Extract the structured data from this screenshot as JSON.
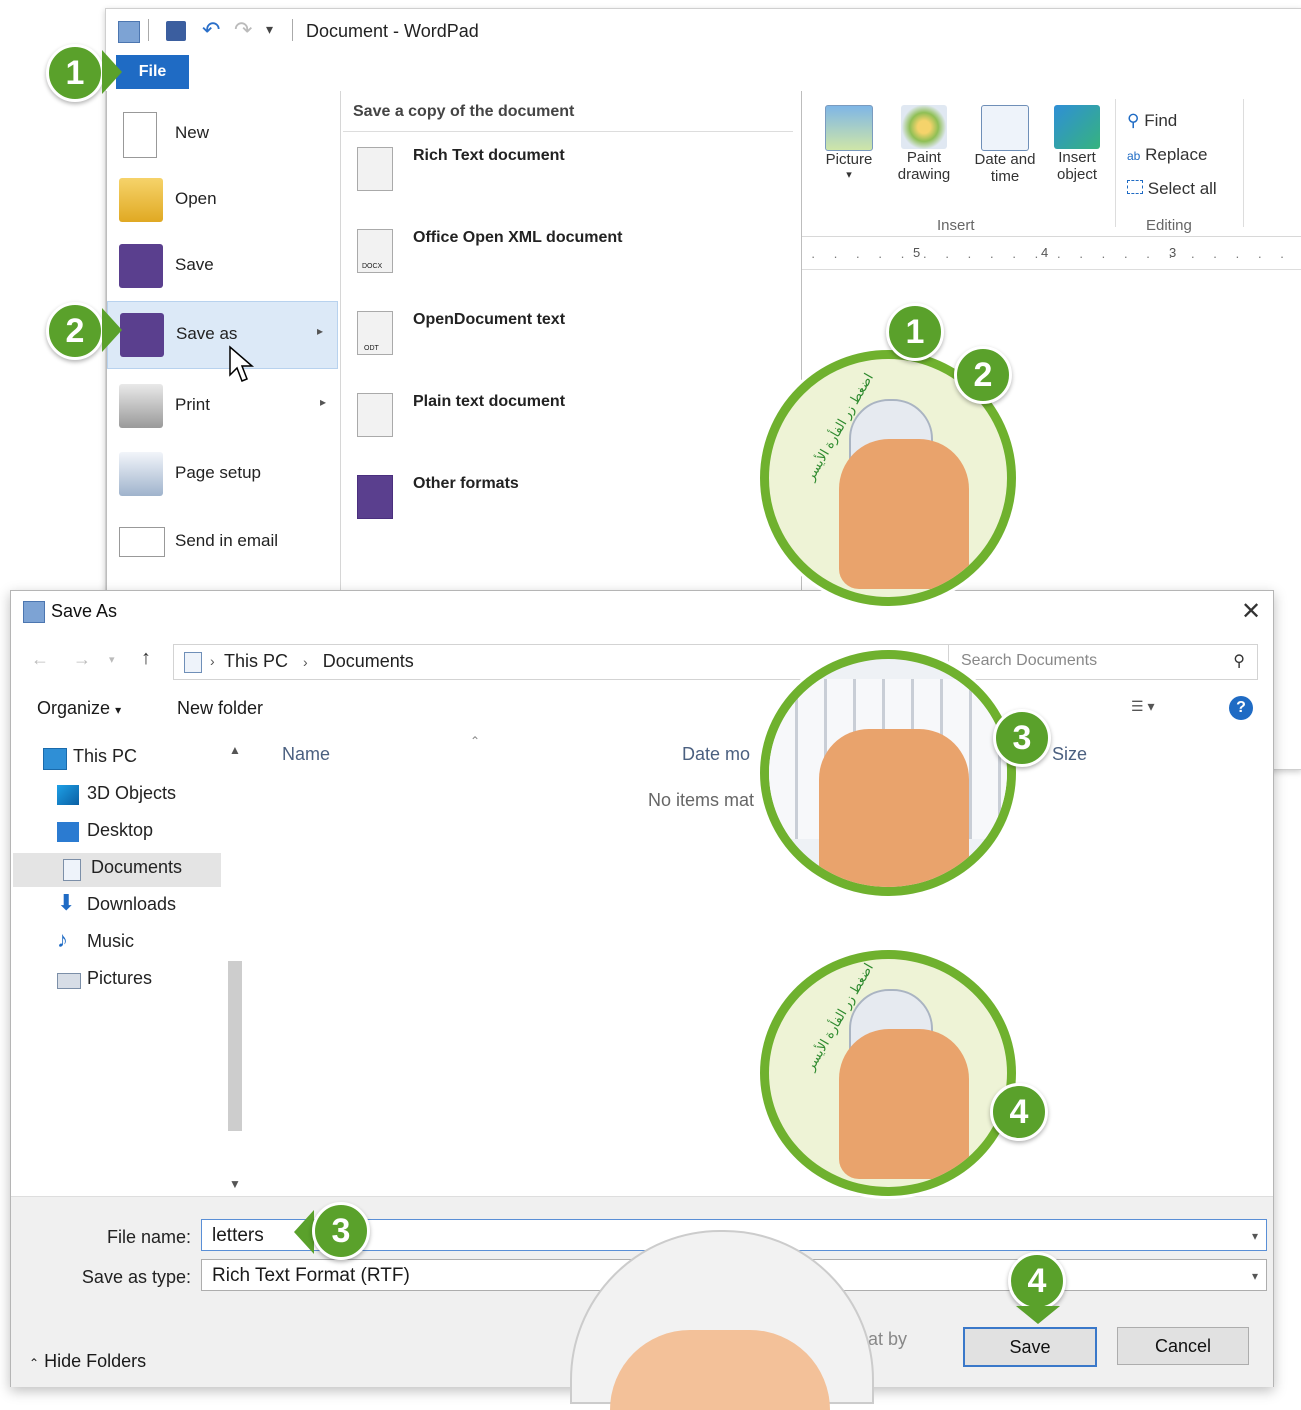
{
  "wordpad": {
    "title": "Document - WordPad",
    "file_tab": "File",
    "ribbon": {
      "insert": {
        "picture": "Picture",
        "paint_drawing": [
          "Paint",
          "drawing"
        ],
        "date_time": [
          "Date and",
          "time"
        ],
        "insert_object": [
          "Insert",
          "object"
        ],
        "group_label": "Insert"
      },
      "editing": {
        "find": "Find",
        "replace": "Replace",
        "select_all": "Select all",
        "group_label": "Editing"
      }
    },
    "ruler_marks": [
      "5",
      "4",
      "3"
    ],
    "file_menu": {
      "items": [
        {
          "label": "New"
        },
        {
          "label": "Open"
        },
        {
          "label": "Save"
        },
        {
          "label": "Save as"
        },
        {
          "label": "Print"
        },
        {
          "label": "Page setup"
        },
        {
          "label": "Send in email"
        }
      ],
      "submenu_title": "Save a copy of the document",
      "submenu": [
        {
          "label": "Rich Text document"
        },
        {
          "label": "Office Open XML document"
        },
        {
          "label": "OpenDocument text"
        },
        {
          "label": "Plain text document"
        },
        {
          "label": "Other formats"
        }
      ],
      "icon_badges": {
        "docx": "DOCX",
        "odt": "ODT"
      }
    }
  },
  "dialog": {
    "title": "Save As",
    "breadcrumb": [
      "This PC",
      "Documents"
    ],
    "search_placeholder": "Search Documents",
    "organize": "Organize",
    "new_folder": "New folder",
    "nav": [
      {
        "label": "This PC",
        "icon": "computer-icon"
      },
      {
        "label": "3D Objects",
        "icon": "cube-icon"
      },
      {
        "label": "Desktop",
        "icon": "desktop-icon"
      },
      {
        "label": "Documents",
        "icon": "document-icon"
      },
      {
        "label": "Downloads",
        "icon": "download-arrow-icon"
      },
      {
        "label": "Music",
        "icon": "music-note-icon"
      },
      {
        "label": "Pictures",
        "icon": "pictures-icon"
      }
    ],
    "columns": {
      "name": "Name",
      "date": "Date mo",
      "size": "Size"
    },
    "empty_message": "No items mat",
    "file_name_label": "File name:",
    "file_name_value": "letters",
    "save_type_label": "Save as type:",
    "save_type_value": "Rich Text Format (RTF)",
    "partial_text": "rmat by",
    "hide_folders": "Hide Folders",
    "save_button": "Save",
    "cancel_button": "Cancel"
  },
  "badges": {
    "b1": "1",
    "b2": "2",
    "b3": "3",
    "b4": "4"
  },
  "illustration_text": "اضغط زر الفأرة الأيسر",
  "colors": {
    "accent_green": "#5aa12b",
    "file_tab_blue": "#1f6bc4",
    "selection": "#dce9f7"
  }
}
